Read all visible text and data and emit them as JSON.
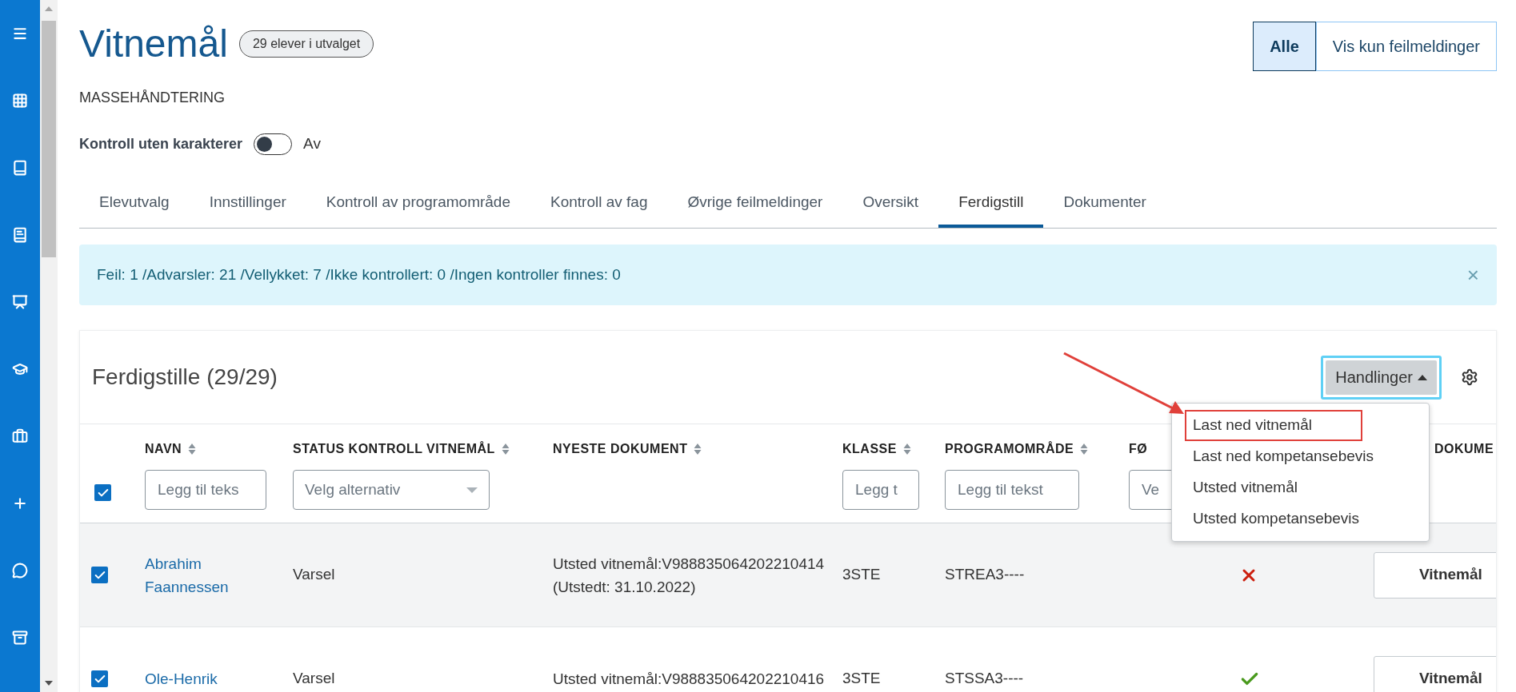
{
  "header": {
    "title": "Vitnemål",
    "badge": "29 elever i utvalget",
    "subtitle": "MASSEHÅNDTERING"
  },
  "filter_toggle": {
    "options": [
      {
        "label": "Alle",
        "selected": true
      },
      {
        "label": "Vis kun feilmeldinger",
        "selected": false
      }
    ]
  },
  "control_switch": {
    "label": "Kontroll uten karakterer",
    "on": false,
    "state_text": "Av"
  },
  "tabs": [
    {
      "label": "Elevutvalg",
      "selected": false
    },
    {
      "label": "Innstillinger",
      "selected": false
    },
    {
      "label": "Kontroll av programområde",
      "selected": false
    },
    {
      "label": "Kontroll av fag",
      "selected": false
    },
    {
      "label": "Øvrige feilmeldinger",
      "selected": false
    },
    {
      "label": "Oversikt",
      "selected": false
    },
    {
      "label": "Ferdigstill",
      "selected": true
    },
    {
      "label": "Dokumenter",
      "selected": false
    }
  ],
  "alert": {
    "text": "Feil: 1 /Advarsler: 21 /Vellykket: 7 /Ikke kontrollert: 0 /Ingen kontroller finnes: 0",
    "close": "×"
  },
  "card": {
    "title": "Ferdigstille (29/29)",
    "actions_button": {
      "label": "Handlinger",
      "expanded": true
    },
    "actions_menu": [
      {
        "label": "Last ned vitnemål",
        "annotated": true
      },
      {
        "label": "Last ned kompetansebevis",
        "annotated": false
      },
      {
        "label": "Utsted vitnemål",
        "annotated": false
      },
      {
        "label": "Utsted kompetansebevis",
        "annotated": false
      }
    ]
  },
  "table": {
    "select_all": {
      "checked": true
    },
    "columns": [
      {
        "label": "NAVN",
        "sortable": true,
        "filter": {
          "kind": "text",
          "placeholder": "Legg til teks"
        }
      },
      {
        "label": "STATUS KONTROLL VITNEMÅL",
        "sortable": true,
        "filter": {
          "kind": "select",
          "placeholder": "Velg alternativ"
        }
      },
      {
        "label": "NYESTE DOKUMENT",
        "sortable": true
      },
      {
        "label": "KLASSE",
        "sortable": true,
        "filter": {
          "kind": "text",
          "placeholder": "Legg t"
        }
      },
      {
        "label": "PROGRAMOMRÅDE",
        "sortable": true,
        "filter": {
          "kind": "text",
          "placeholder": "Legg til tekst"
        }
      },
      {
        "label": "FØ",
        "filter": {
          "kind": "text",
          "placeholder": "Ve"
        }
      },
      {
        "label": "DOKUME"
      }
    ],
    "rows": [
      {
        "checked": true,
        "shaded": true,
        "name": "Abrahim Faannessen",
        "status": "Varsel",
        "document": "Utsted vitnemål:V988835064202210414 (Utstedt: 31.10.2022)",
        "class": "3STE",
        "program": "STREA3----",
        "passed": false,
        "button": "Vitnemål"
      },
      {
        "checked": true,
        "shaded": false,
        "name": "Ole-Henrik",
        "status": "Varsel",
        "document": "Utsted vitnemål:V988835064202210416",
        "class": "3STE",
        "program": "STSSA3----",
        "passed": true,
        "button": "Vitnemål"
      }
    ]
  }
}
